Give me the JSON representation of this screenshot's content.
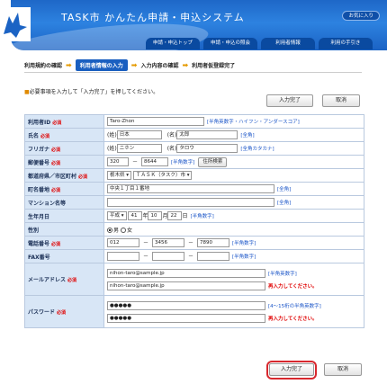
{
  "header": {
    "title": "TASK市 かんたん申請・申込システム",
    "favorite": "お気に入り",
    "nav": [
      "申請・申込トップ",
      "申請・申込の照会",
      "利用者情報",
      "利用の手引き"
    ]
  },
  "steps": [
    "利用規約の確認",
    "利用者情報の入力",
    "入力内容の確認",
    "利用者仮登録完了"
  ],
  "notice": "必要事項を入力して「入力完了」を押してください。",
  "buttons": {
    "complete": "入力完了",
    "cancel": "取消"
  },
  "required": "必須",
  "form": {
    "user_id": {
      "label": "利用者ID",
      "value": "Taro-Zhon",
      "hint": "[半角英数字・ハイフン・アンダースコア]"
    },
    "name": {
      "label": "氏名",
      "sei_label": "(姓)",
      "sei": "日本",
      "mei_label": "(名)",
      "mei": "太郎",
      "hint": "[全角]"
    },
    "furigana": {
      "label": "フリガナ",
      "sei_label": "(姓)",
      "sei": "ニホン",
      "mei_label": "(名)",
      "mei": "タロウ",
      "hint": "[全角カタカナ]"
    },
    "postal": {
      "label": "郵便番号",
      "part1": "320",
      "part2": "8644",
      "hint": "[半角数字]",
      "search": "住所検索"
    },
    "pref_city": {
      "label": "都道府県／市区町村",
      "pref": "栃木県",
      "city": "ＴＡＳＫ（タスク）市"
    },
    "address": {
      "label": "町名番地",
      "value": "中央１丁目１番地",
      "hint": "[全角]"
    },
    "building": {
      "label": "マンション名等",
      "value": "",
      "hint": "[全角]"
    },
    "birthday": {
      "label": "生年月日",
      "era": "平成",
      "year": "41",
      "year_unit": "年",
      "month": "10",
      "month_unit": "月",
      "day": "22",
      "day_unit": "日",
      "hint": "[半角数字]"
    },
    "gender": {
      "label": "性別",
      "male": "男",
      "female": "女"
    },
    "phone": {
      "label": "電話番号",
      "p1": "012",
      "p2": "3456",
      "p3": "7890",
      "hint": "[半角数字]"
    },
    "fax": {
      "label": "FAX番号",
      "p1": "",
      "p2": "",
      "p3": "",
      "hint": "[半角数字]"
    },
    "email": {
      "label": "メールアドレス",
      "value": "nihon-taro@sample.jp",
      "confirm": "nihon-taro@sample.jp",
      "hint": "[半角英数字]",
      "error": "再入力してください。"
    },
    "password": {
      "label": "パスワード",
      "value": "●●●●●",
      "confirm": "●●●●●",
      "hint": "[4～15桁の半角英数字]",
      "error": "再入力してください。"
    }
  }
}
